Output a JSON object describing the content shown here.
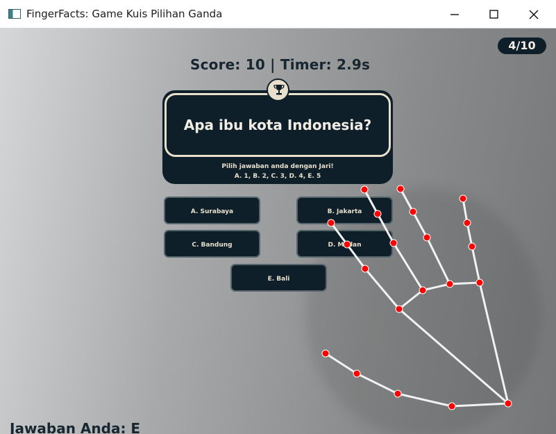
{
  "window": {
    "title": "FingerFacts: Game Kuis Pilihan Ganda",
    "minimize_label": "",
    "maximize_label": "",
    "close_label": ""
  },
  "game": {
    "progress": "4/10",
    "score_text": "Score: 10 | Timer: 2.9s",
    "question": "Apa ibu kota Indonesia?",
    "instruction_line_1": "Pilih jawaban anda dengan Jari!",
    "instruction_line_2": "A. 1, B. 2, C. 3, D. 4, E. 5",
    "answers": [
      "A. Surabaya",
      "B. Jakarta",
      "C. Bandung",
      "D. Medan",
      "E. Bali"
    ],
    "your_answer": "Jawaban Anda: E"
  },
  "colors": {
    "panel": "#0f1f2a",
    "text_light": "#e8dfcc",
    "landmark": "#ff0000",
    "connector": "#ffffff"
  },
  "icons": {
    "app": "window-app-icon",
    "minimize": "minimize-icon",
    "maximize": "maximize-icon",
    "close": "close-icon",
    "question": "trophy-icon"
  }
}
